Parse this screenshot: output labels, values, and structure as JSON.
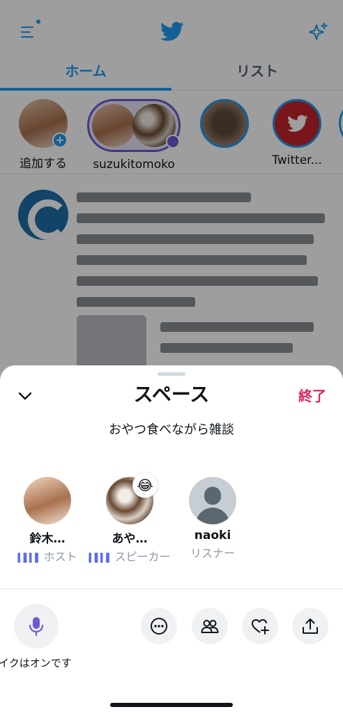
{
  "colors": {
    "accent": "#1d9bf0",
    "end": "#e0245e",
    "wave": "#5b6cf2",
    "role_gray": "#8b98a5"
  },
  "header": {
    "menu_icon": "menu-icon",
    "logo_icon": "twitter-bird-icon",
    "sparkle_icon": "sparkle-icon"
  },
  "tabs": [
    {
      "label": "ホーム",
      "active": true
    },
    {
      "label": "リスト",
      "active": false
    }
  ],
  "fleets": [
    {
      "label": "追加する"
    },
    {
      "label": "suzukitomoko"
    },
    {
      "label": ""
    },
    {
      "label": "Twitter..."
    }
  ],
  "sheet": {
    "title": "スペース",
    "end_label": "終了",
    "space_name": "おやつ食べながら雑談",
    "participants": [
      {
        "name": "鈴木…",
        "role": "ホスト"
      },
      {
        "name": "あや…",
        "role": "スピーカー",
        "reaction": "😂"
      },
      {
        "name": "naoki",
        "role": "リスナー"
      }
    ],
    "mic_label": "イクはオンです"
  }
}
